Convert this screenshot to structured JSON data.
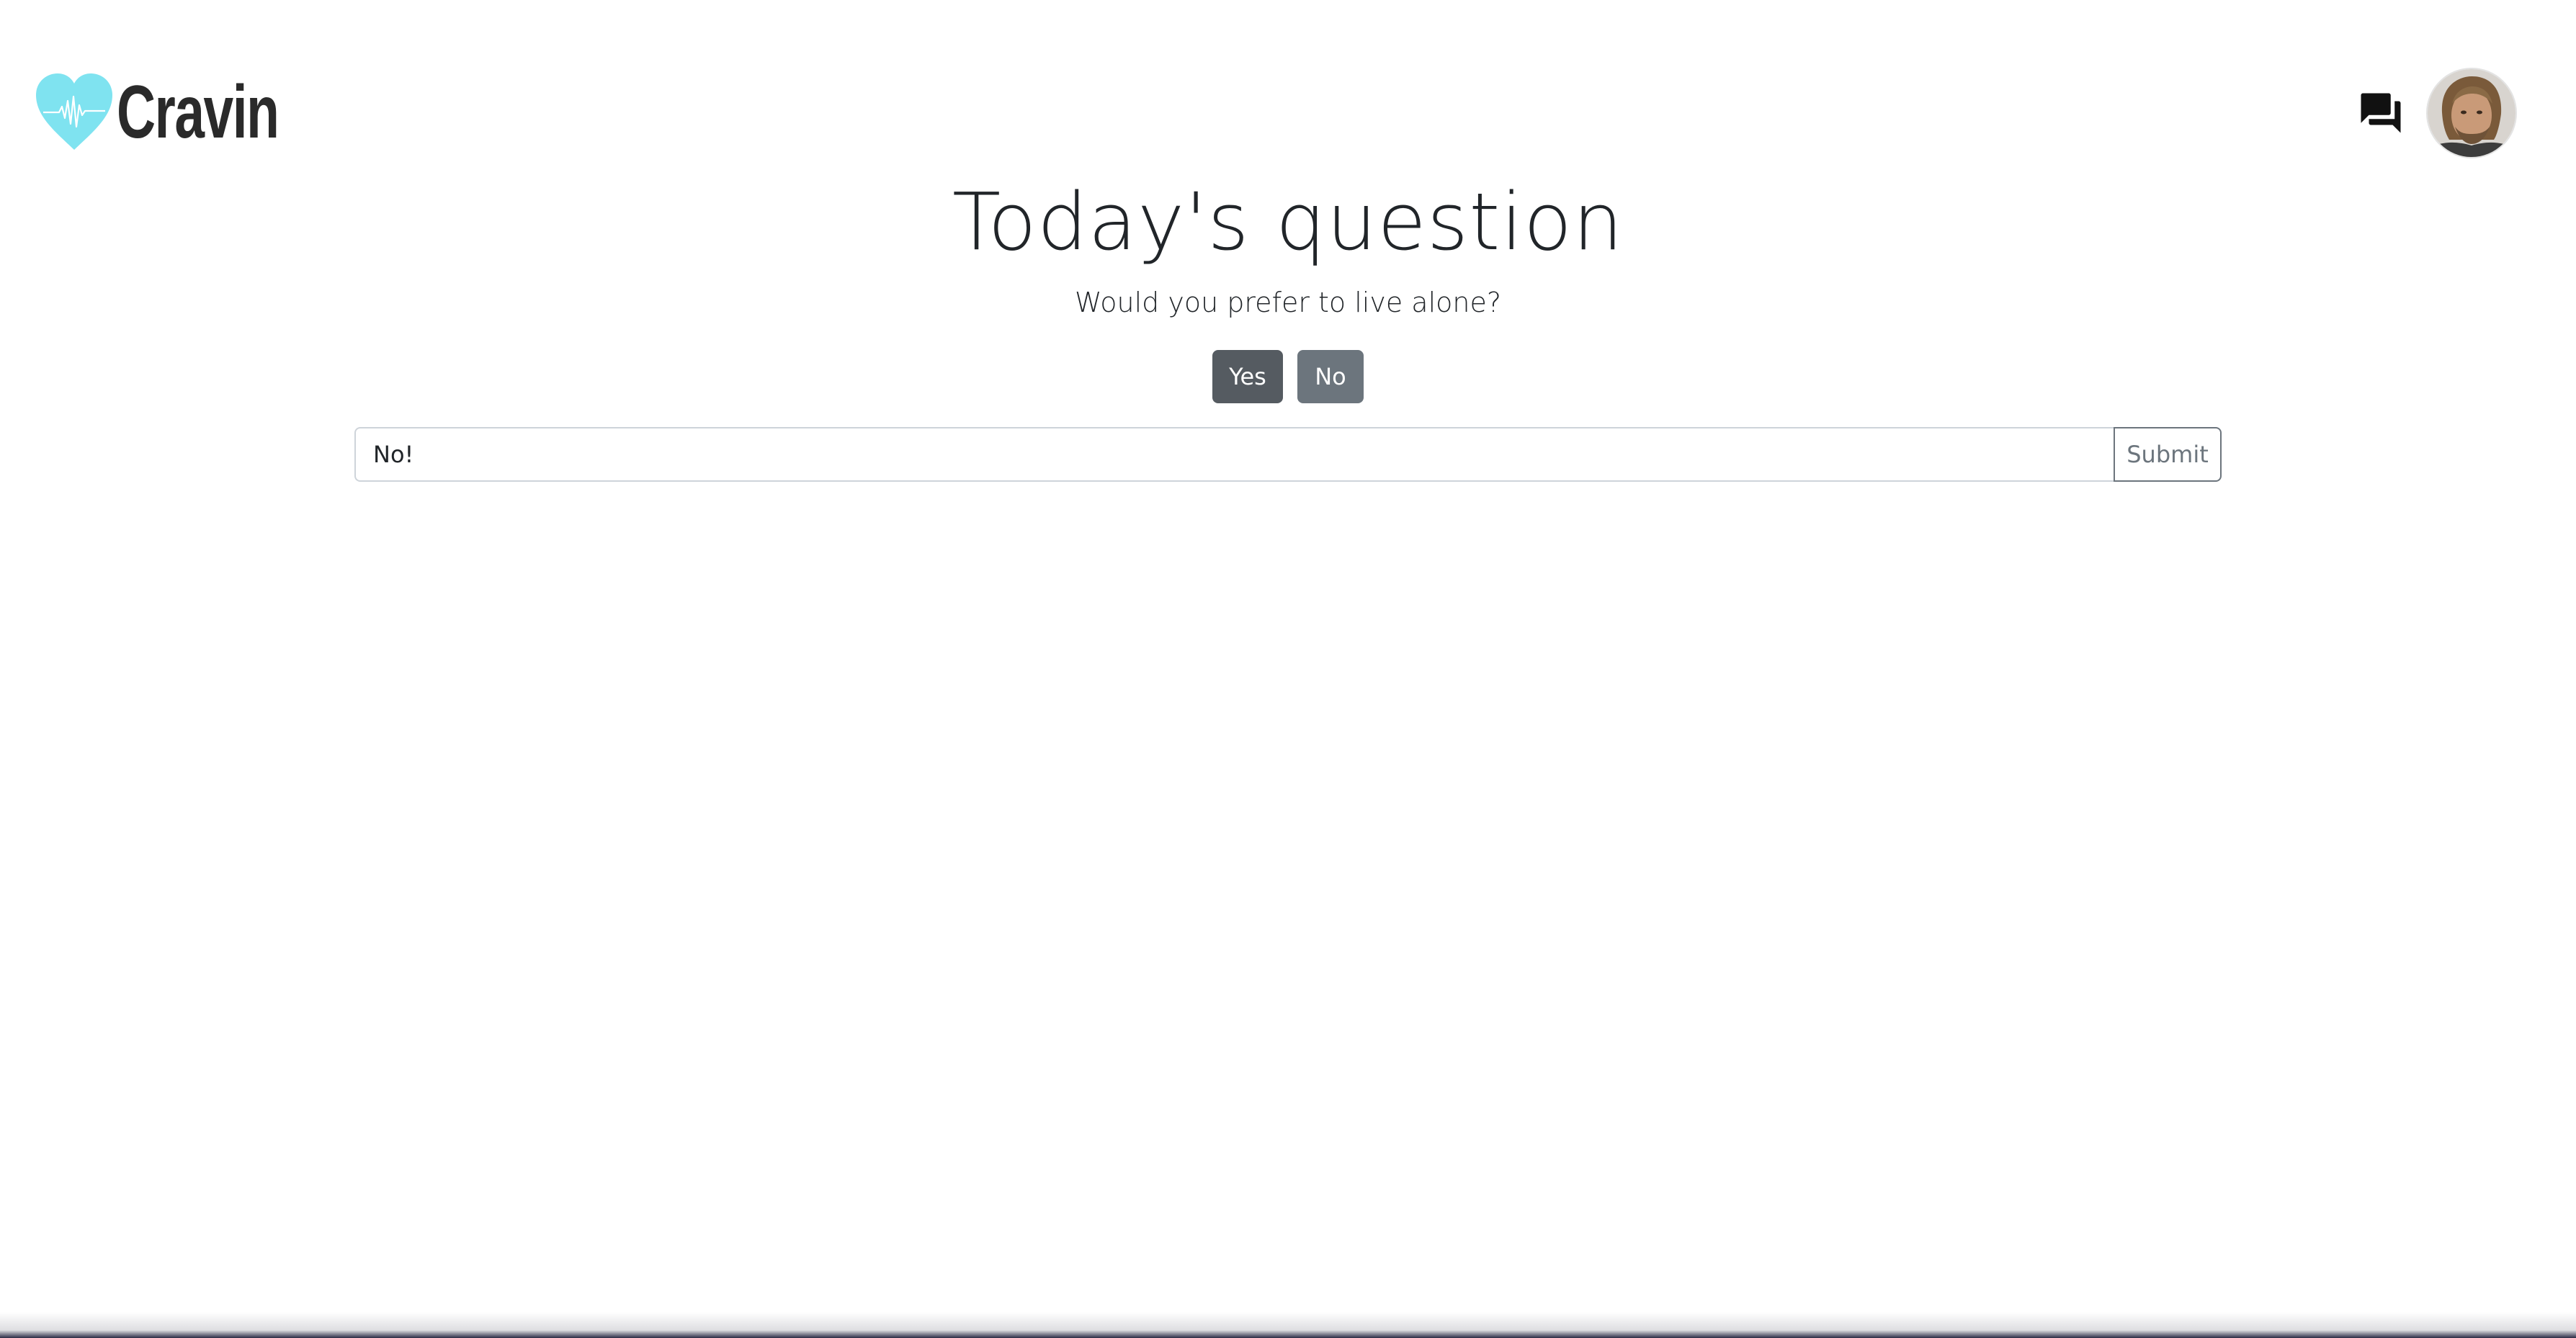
{
  "brand": {
    "name": "Cravin",
    "logo_icon": "heart-pulse-icon",
    "accent_color": "#7fe3f0"
  },
  "header": {
    "chat_icon": "chat-bubbles-icon",
    "avatar_icon": "user-avatar"
  },
  "main": {
    "title": "Today's question",
    "question": "Would you prefer to live alone?",
    "yes_label": "Yes",
    "no_label": "No",
    "answer_value": "No!",
    "submit_label": "Submit"
  },
  "colors": {
    "yes_button": "#555b61",
    "no_button": "#6c757d",
    "submit_border": "#6c757d"
  }
}
